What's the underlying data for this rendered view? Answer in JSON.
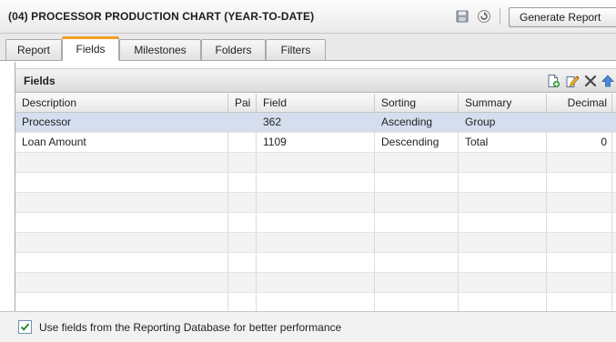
{
  "window": {
    "title": "(04) PROCESSOR PRODUCTION CHART (YEAR-TO-DATE)",
    "generate_label": "Generate Report"
  },
  "tabs": [
    {
      "label": "Report"
    },
    {
      "label": "Fields",
      "active": true
    },
    {
      "label": "Milestones"
    },
    {
      "label": "Folders"
    },
    {
      "label": "Filters"
    }
  ],
  "panel": {
    "title": "Fields",
    "toolbar_icons": [
      "new-icon",
      "edit-icon",
      "delete-icon",
      "move-up-icon",
      "move-down-icon"
    ]
  },
  "table": {
    "columns": [
      "Description",
      "Pai",
      "Field",
      "Sorting",
      "Summary",
      "Decimal"
    ],
    "rows": [
      {
        "description": "Processor",
        "pai": "",
        "field": "362",
        "sorting": "Ascending",
        "summary": "Group",
        "decimal": ""
      },
      {
        "description": "Loan Amount",
        "pai": "",
        "field": "1109",
        "sorting": "Descending",
        "summary": "Total",
        "decimal": "0"
      }
    ],
    "selected_row": 0
  },
  "footer": {
    "checkbox_checked": true,
    "checkbox_label": "Use fields from the Reporting Database for better performance"
  },
  "colors": {
    "active_tab_accent": "#f0a020",
    "selected_row": "#d5deef",
    "checkmark": "#2e8b2e",
    "arrow_blue": "#3a78d0"
  }
}
